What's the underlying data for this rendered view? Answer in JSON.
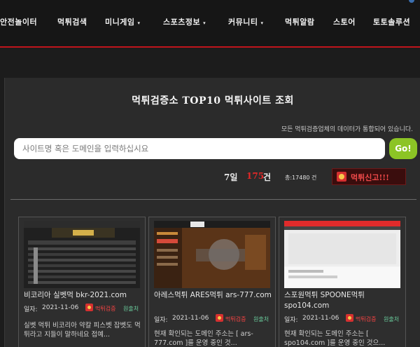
{
  "nav": {
    "items": [
      {
        "label": "안전놀이터",
        "caret": false
      },
      {
        "label": "먹튀검색",
        "caret": false
      },
      {
        "label": "미니게임",
        "caret": true
      },
      {
        "label": "스포츠정보",
        "caret": true
      },
      {
        "label": "커뮤니티",
        "caret": true
      },
      {
        "label": "먹튀알람",
        "caret": false
      },
      {
        "label": "스토어",
        "caret": false
      },
      {
        "label": "토토솔루션",
        "caret": false
      }
    ],
    "caret_glyph": "▾"
  },
  "main": {
    "title": "먹튀검증소 TOP10 먹튀사이트 조회",
    "notice": "모든 먹튀검증업체의 데이터가 통합되어 있습니다.",
    "search": {
      "placeholder": "사이트명 혹은 도메인을 입력하십시요",
      "value": "",
      "button_label": "Go!"
    },
    "stats": {
      "days_label": "7일",
      "count": "175",
      "count_unit": "건",
      "total": "총:17480 건"
    },
    "report_button": "먹튀신고!!!"
  },
  "cards": [
    {
      "name": "비코리아 실벳먹 bkr-2021.com",
      "date_label": "일자:",
      "date": "2021-11-06",
      "badge": "먹튀검증",
      "tag": "원출처",
      "desc": "실벳 먹튀 비코리아 약칼 피스벳 잡벳도 먹튀라고 지들이 말하네요  접예..."
    },
    {
      "name": "아레스먹튀 ARES먹튀 ars-777.com",
      "date_label": "일자:",
      "date": "2021-11-06",
      "badge": "먹튀검증",
      "tag": "원출처",
      "desc": "현재 확인되는 도메인 주소는 [ ars-777.com ]를 운영 중인 것..."
    },
    {
      "name": "스포원먹튀 SPOONE먹튀 spo104.com",
      "date_label": "일자:",
      "date": "2021-11-06",
      "badge": "먹튀검증",
      "tag": "원출처",
      "desc": "현재 확인되는 도메인 주소는 [ spo104.com ]를 운영 중인 것으..."
    }
  ],
  "colors": {
    "accent_red": "#c0141c",
    "go_green": "#8cc425",
    "count_red": "#e52727",
    "panel_bg": "#2b2b2b"
  }
}
